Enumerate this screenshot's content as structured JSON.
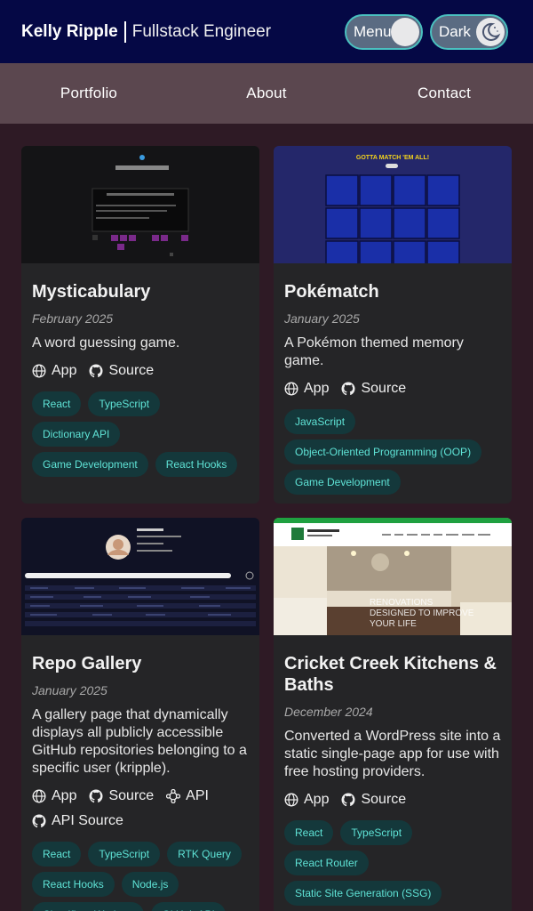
{
  "header": {
    "name": "Kelly Ripple",
    "role": "Fullstack Engineer",
    "menu_toggle_label": "Menu",
    "dark_toggle_label": "Dark"
  },
  "nav": {
    "items": [
      "Portfolio",
      "About",
      "Contact"
    ]
  },
  "link_labels": {
    "app": "App",
    "source": "Source",
    "api": "API",
    "api_source": "API Source"
  },
  "projects": [
    {
      "title": "Mysticabulary",
      "date": "February 2025",
      "description": "A word guessing game.",
      "tags": [
        "React",
        "TypeScript",
        "Dictionary API",
        "Game Development",
        "React Hooks"
      ]
    },
    {
      "title": "Pokématch",
      "date": "January 2025",
      "description": "A Pokémon themed memory game.",
      "thumb_text": "GOTTA MATCH 'EM ALL!",
      "tags": [
        "JavaScript",
        "Object-Oriented Programming (OOP)",
        "Game Development"
      ]
    },
    {
      "title": "Repo Gallery",
      "date": "January 2025",
      "description": "A gallery page that dynamically displays all publicly accessible GitHub repositories belonging to a specific user (kripple).",
      "tags": [
        "React",
        "TypeScript",
        "RTK Query",
        "React Hooks",
        "Node.js",
        "Cloudflare Workers",
        "GitHub API"
      ]
    },
    {
      "title": "Cricket Creek Kitchens & Baths",
      "date": "December 2024",
      "description": "Converted a WordPress site into a static single-page app for use with free hosting providers.",
      "thumb_text": "RENOVATIONS DESIGNED TO IMPROVE YOUR LIFE",
      "tags": [
        "React",
        "TypeScript",
        "React Router",
        "Static Site Generation (SSG)"
      ]
    }
  ],
  "colors": {
    "header_bg": "#050845",
    "nav_bg": "#5b474f",
    "page_bg": "#2e1a25",
    "card_bg": "#252527",
    "tag_bg": "#14383b",
    "tag_text": "#5fe3d6",
    "toggle_border": "#4ac1c0"
  }
}
